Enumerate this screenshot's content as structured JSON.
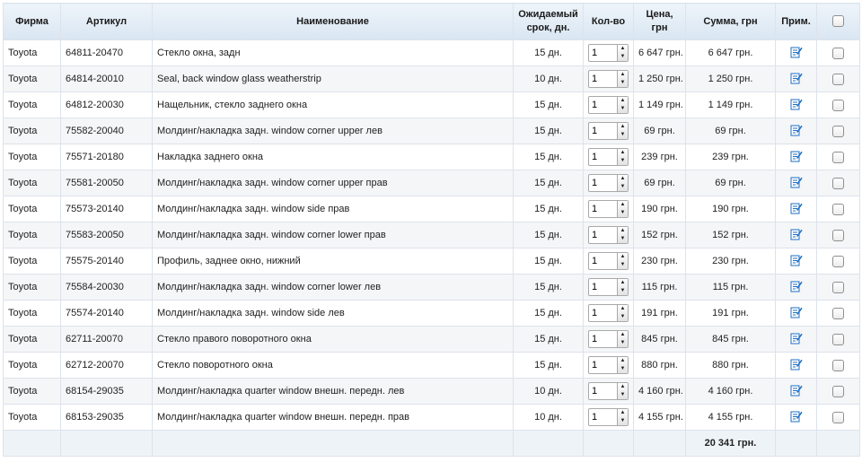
{
  "table": {
    "headers": {
      "firm": "Фирма",
      "article": "Артикул",
      "name": "Наименование",
      "term_line1": "Ожидаемый",
      "term_line2": "срок, дн.",
      "qty": "Кол-во",
      "price_line1": "Цена,",
      "price_line2": "грн",
      "sum": "Сумма, грн",
      "note": "Прим."
    },
    "rows": [
      {
        "firm": "Toyota",
        "article": "64811-20470",
        "name": "Стекло окна, задн",
        "term": "15 дн.",
        "qty": "1",
        "price": "6 647 грн.",
        "sum": "6 647 грн."
      },
      {
        "firm": "Toyota",
        "article": "64814-20010",
        "name": "Seal, back window glass weatherstrip",
        "term": "10 дн.",
        "qty": "1",
        "price": "1 250 грн.",
        "sum": "1 250 грн."
      },
      {
        "firm": "Toyota",
        "article": "64812-20030",
        "name": "Нащельник, стекло заднего окна",
        "term": "15 дн.",
        "qty": "1",
        "price": "1 149 грн.",
        "sum": "1 149 грн."
      },
      {
        "firm": "Toyota",
        "article": "75582-20040",
        "name": "Молдинг/накладка задн. window corner upper лев",
        "term": "15 дн.",
        "qty": "1",
        "price": "69 грн.",
        "sum": "69 грн."
      },
      {
        "firm": "Toyota",
        "article": "75571-20180",
        "name": "Накладка заднего окна",
        "term": "15 дн.",
        "qty": "1",
        "price": "239 грн.",
        "sum": "239 грн."
      },
      {
        "firm": "Toyota",
        "article": "75581-20050",
        "name": "Молдинг/накладка задн. window corner upper прав",
        "term": "15 дн.",
        "qty": "1",
        "price": "69 грн.",
        "sum": "69 грн."
      },
      {
        "firm": "Toyota",
        "article": "75573-20140",
        "name": "Молдинг/накладка задн. window side прав",
        "term": "15 дн.",
        "qty": "1",
        "price": "190 грн.",
        "sum": "190 грн."
      },
      {
        "firm": "Toyota",
        "article": "75583-20050",
        "name": "Молдинг/накладка задн. window corner lower прав",
        "term": "15 дн.",
        "qty": "1",
        "price": "152 грн.",
        "sum": "152 грн."
      },
      {
        "firm": "Toyota",
        "article": "75575-20140",
        "name": "Профиль, заднее окно, нижний",
        "term": "15 дн.",
        "qty": "1",
        "price": "230 грн.",
        "sum": "230 грн."
      },
      {
        "firm": "Toyota",
        "article": "75584-20030",
        "name": "Молдинг/накладка задн. window corner lower лев",
        "term": "15 дн.",
        "qty": "1",
        "price": "115 грн.",
        "sum": "115 грн."
      },
      {
        "firm": "Toyota",
        "article": "75574-20140",
        "name": "Молдинг/накладка задн. window side лев",
        "term": "15 дн.",
        "qty": "1",
        "price": "191 грн.",
        "sum": "191 грн."
      },
      {
        "firm": "Toyota",
        "article": "62711-20070",
        "name": "Стекло правого поворотного окна",
        "term": "15 дн.",
        "qty": "1",
        "price": "845 грн.",
        "sum": "845 грн."
      },
      {
        "firm": "Toyota",
        "article": "62712-20070",
        "name": "Стекло поворотного окна",
        "term": "15 дн.",
        "qty": "1",
        "price": "880 грн.",
        "sum": "880 грн."
      },
      {
        "firm": "Toyota",
        "article": "68154-29035",
        "name": "Молдинг/накладка quarter window внешн. передн. лев",
        "term": "10 дн.",
        "qty": "1",
        "price": "4 160 грн.",
        "sum": "4 160 грн."
      },
      {
        "firm": "Toyota",
        "article": "68153-29035",
        "name": "Молдинг/накладка quarter window внешн. передн. прав",
        "term": "10 дн.",
        "qty": "1",
        "price": "4 155 грн.",
        "sum": "4 155 грн."
      }
    ],
    "total": "20 341 грн.",
    "note_icon": "edit-note-icon",
    "colors": {
      "header_top": "#eef4fa",
      "header_bottom": "#d9e6f2",
      "note_icon": "#1f6fc5",
      "border": "#dde3ea"
    }
  }
}
